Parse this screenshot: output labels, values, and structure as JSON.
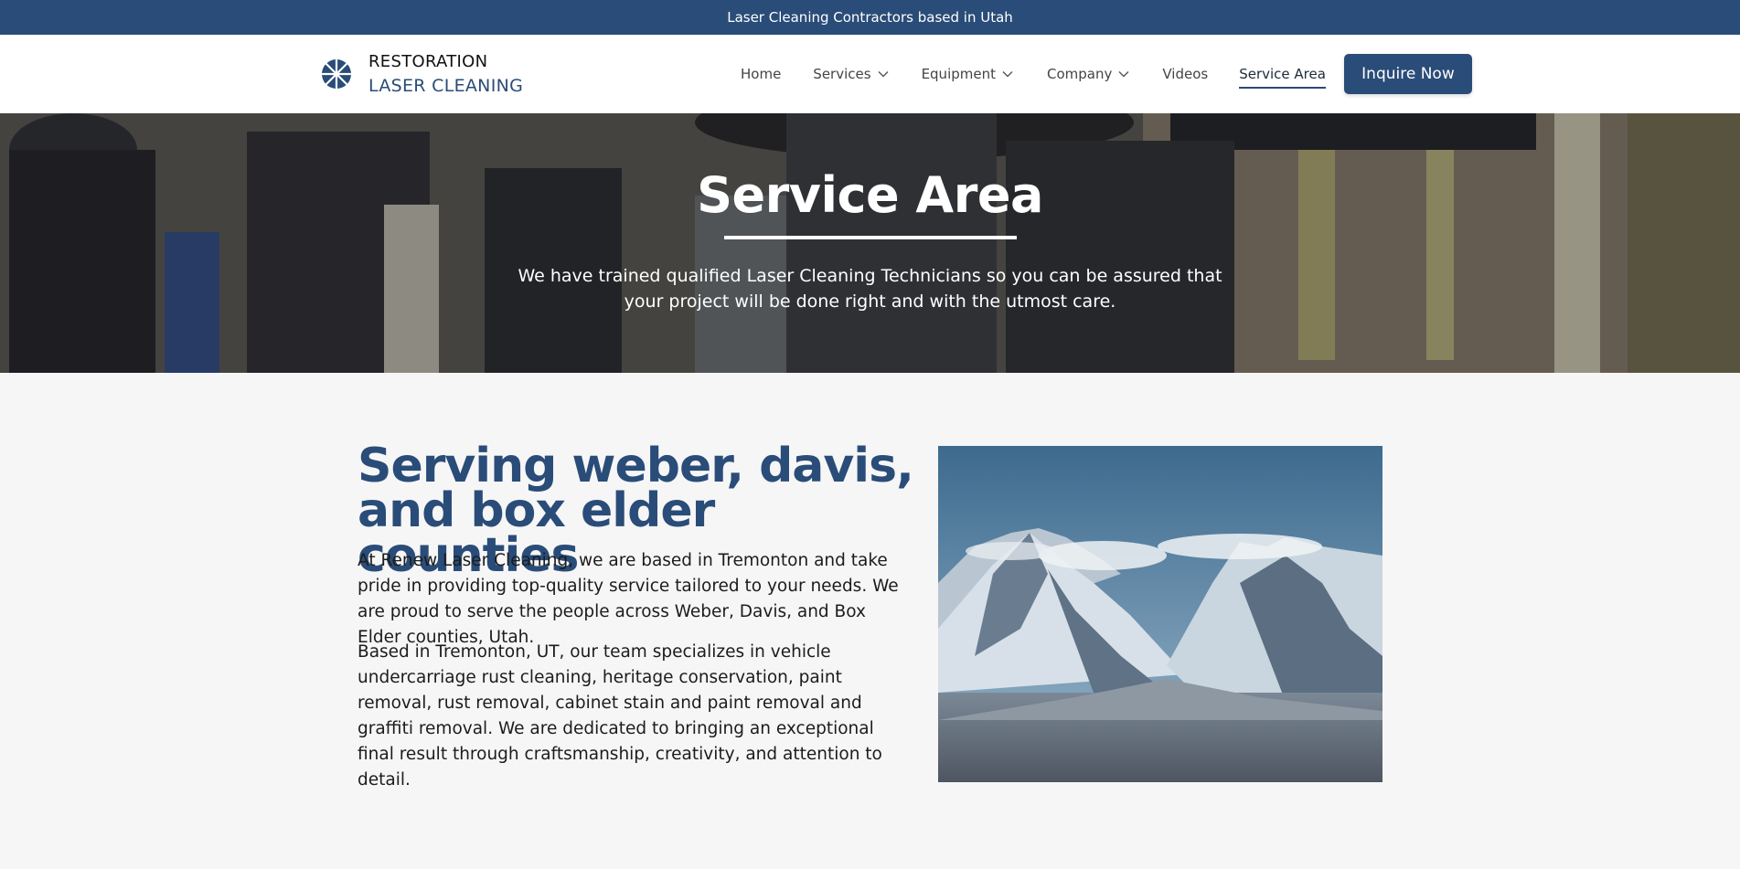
{
  "topbar": {
    "text": "Laser Cleaning Contractors based in Utah"
  },
  "logo": {
    "line1": "RESTORATION",
    "line2": "LASER CLEANING"
  },
  "nav": {
    "items": [
      {
        "label": "Home",
        "dropdown": false,
        "active": false
      },
      {
        "label": "Services",
        "dropdown": true,
        "active": false
      },
      {
        "label": "Equipment",
        "dropdown": true,
        "active": false
      },
      {
        "label": "Company",
        "dropdown": true,
        "active": false
      },
      {
        "label": "Videos",
        "dropdown": false,
        "active": false
      },
      {
        "label": "Service Area",
        "dropdown": false,
        "active": true
      }
    ],
    "cta": "Inquire Now"
  },
  "hero": {
    "title": "Service Area",
    "subtitle": "We have trained qualified Laser Cleaning Technicians so you can be assured that your project will be done right and with the utmost care."
  },
  "main": {
    "heading": "Serving weber, davis, and box elder counties",
    "paragraphs": [
      "At Renew Laser Cleaning, we are based in Tremonton and take pride in providing top-quality service tailored to your needs. We are proud to serve the people across Weber, Davis, and Box Elder counties, Utah.",
      "Based in Tremonton, UT, our team specializes in vehicle undercarriage rust cleaning, heritage conservation, paint removal, rust removal, cabinet stain and paint removal and graffiti removal. We are dedicated to bringing an exceptional final result through craftsmanship, creativity, and attention to detail."
    ]
  },
  "colors": {
    "brand": "#2a4c78",
    "background": "#f6f6f6",
    "white": "#ffffff"
  },
  "icons": {
    "logo": "laser-burst-logo-icon",
    "dropdown": "chevron-down-icon"
  }
}
